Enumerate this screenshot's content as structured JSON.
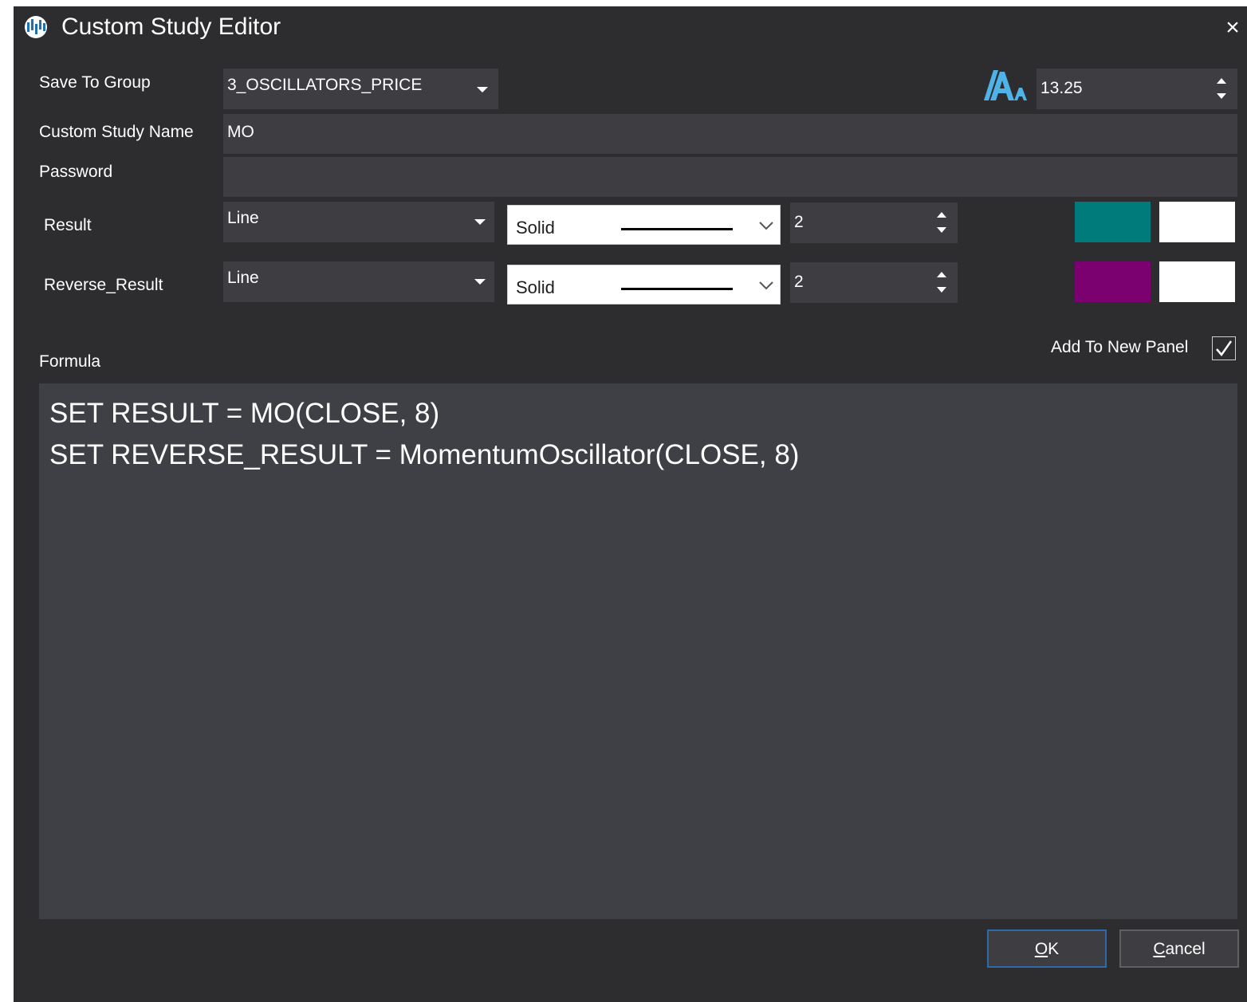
{
  "window": {
    "title": "Custom Study Editor",
    "close_glyph": "×"
  },
  "form": {
    "save_to_group_label": "Save To Group",
    "save_to_group_value": "3_OSCILLATORS_PRICE",
    "font_size_icon": "text-size-icon",
    "font_size_value": "13.25",
    "custom_study_name_label": "Custom Study Name",
    "custom_study_name_value": "MO",
    "password_label": "Password",
    "password_value": ""
  },
  "series": [
    {
      "label": "Result",
      "chart_type": "Line",
      "line_style": "Solid",
      "line_width": "2",
      "color": "#007b7b",
      "color2": "#ffffff"
    },
    {
      "label": "Reverse_Result",
      "chart_type": "Line",
      "line_style": "Solid",
      "line_width": "2",
      "color": "#7b0070",
      "color2": "#ffffff"
    }
  ],
  "add_to_new_panel": {
    "label": "Add To New Panel",
    "checked": true
  },
  "formula": {
    "label": "Formula",
    "lines": [
      "SET RESULT = MO(CLOSE, 8)",
      "SET REVERSE_RESULT = MomentumOscillator(CLOSE, 8)"
    ]
  },
  "buttons": {
    "ok_mnemonic": "O",
    "ok_rest": "K",
    "cancel_mnemonic": "C",
    "cancel_rest": "ancel"
  },
  "colors": {
    "window_bg": "#2d2d30",
    "field_bg": "#3e3e42",
    "accent_blue": "#4fb3e8"
  }
}
